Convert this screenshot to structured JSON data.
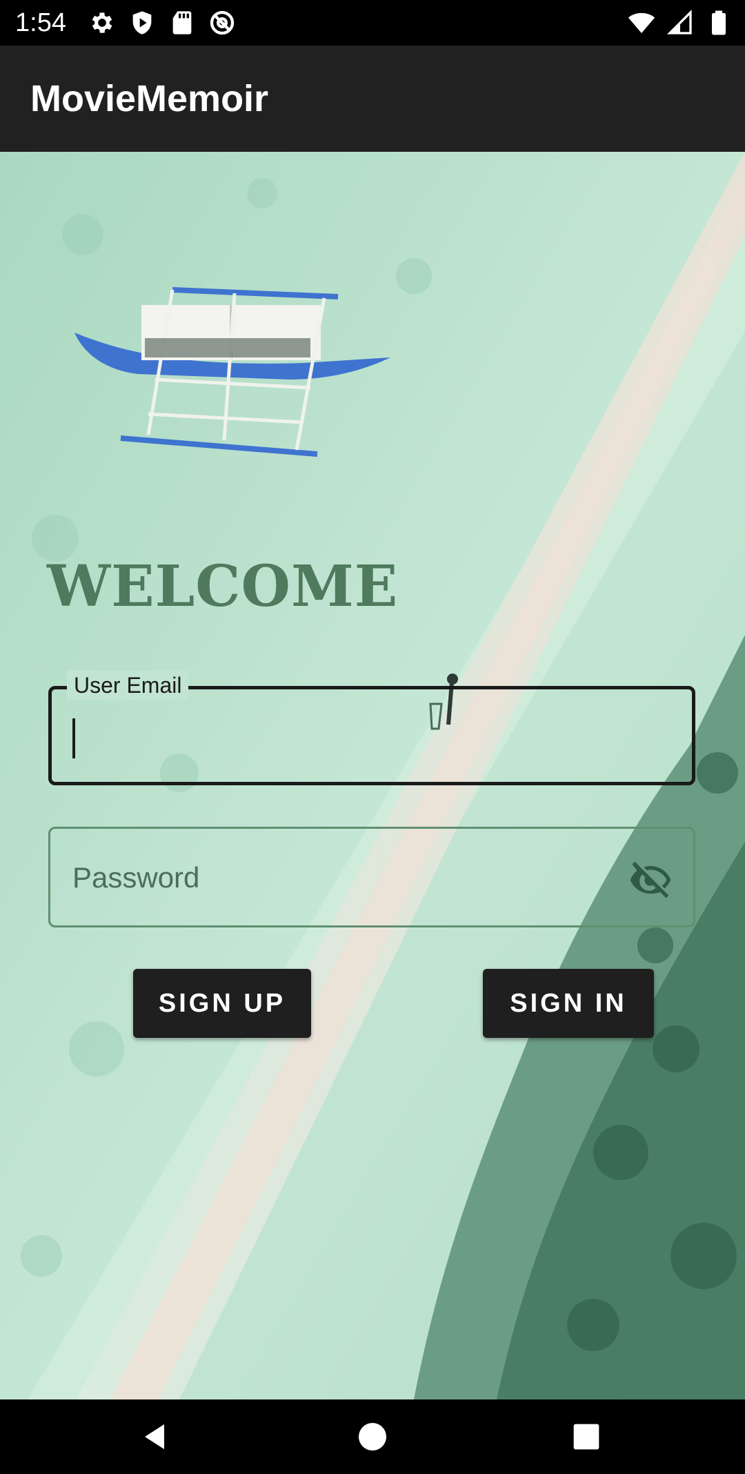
{
  "status_bar": {
    "time": "1:54",
    "left_icons": [
      "gear-icon",
      "shield-icon",
      "sd-card-icon",
      "at-sign-icon"
    ],
    "right_icons": [
      "wifi-icon",
      "signal-icon",
      "battery-icon"
    ]
  },
  "app_bar": {
    "title": "MovieMemoir"
  },
  "login": {
    "welcome": "WELCOME",
    "email_label": "User Email",
    "email_value": "",
    "password_placeholder": "Password",
    "password_toggle_icon": "eye-off-icon",
    "signup_label": "SIGN UP",
    "signin_label": "SIGN IN"
  },
  "nav_bar": {
    "icons": [
      "back-icon",
      "home-icon",
      "recents-icon"
    ]
  },
  "colors": {
    "app_bar": "#212121",
    "welcome_text": "#4f7a5d",
    "button_bg": "#1f1f1f",
    "button_text": "#ffffff"
  }
}
